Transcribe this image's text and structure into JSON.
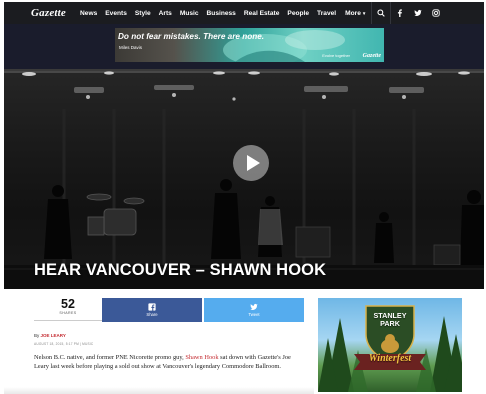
{
  "nav": {
    "logo": "Gazette",
    "items": [
      "News",
      "Events",
      "Style",
      "Arts",
      "Music",
      "Business",
      "Real Estate",
      "People",
      "Travel"
    ],
    "more": "More",
    "icons": [
      "search-icon",
      "facebook-icon",
      "twitter-icon",
      "instagram-icon"
    ]
  },
  "banner_ad": {
    "headline": "Do not fear mistakes. There are none.",
    "attribution": "Miles Davis",
    "tagline": "Evolve together",
    "brand": "Gazette"
  },
  "hero": {
    "title": "HEAR VANCOUVER – SHAWN HOOK",
    "play_icon": "play-icon"
  },
  "share": {
    "count": "52",
    "label": "SHARES",
    "facebook_label": "Share",
    "twitter_label": "Tweet"
  },
  "article": {
    "by_prefix": "By",
    "author": "JOE LEARY",
    "date_meta": "AUGUST 18, 2015, 5:17 PM | MUSIC",
    "body_before": "Nelson B.C. native, and former PNE Nicorette promo guy, ",
    "body_link": "Shawn Hook",
    "body_after": " sat down with Gazette's Joe Leary last week before playing a sold out show at Vancouver's legendary Commodore Ballroom."
  },
  "side_ad": {
    "title": "STANLEY PARK",
    "wordmark": "Winterfest"
  },
  "colors": {
    "nav_bg": "#1b1c20",
    "facebook": "#3b5998",
    "twitter": "#55acee",
    "link_red": "#c42b31"
  }
}
